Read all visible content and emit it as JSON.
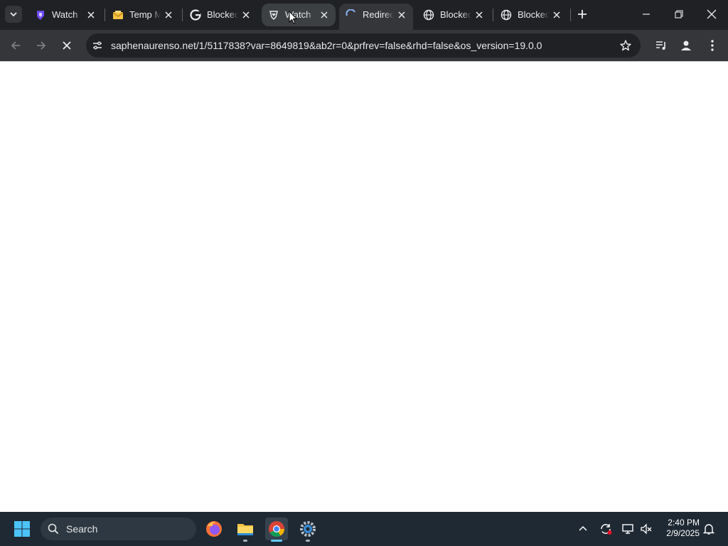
{
  "tabs": [
    {
      "title": "Watch",
      "favicon": "proton-vpn-icon",
      "state": "normal"
    },
    {
      "title": "Temp Mail",
      "favicon": "temp-mail-icon",
      "state": "normal"
    },
    {
      "title": "Blocked",
      "favicon": "google-icon",
      "state": "normal"
    },
    {
      "title": "Watch",
      "favicon": "brave-icon",
      "state": "hover"
    },
    {
      "title": "Redirecting",
      "favicon": "loading-spinner-icon",
      "state": "active"
    },
    {
      "title": "Blocked",
      "favicon": "globe-icon",
      "state": "normal"
    },
    {
      "title": "Blocked",
      "favicon": "globe-icon",
      "state": "normal"
    }
  ],
  "address_bar": {
    "url": "saphenaurenso.net/1/5117838?var=8649819&ab2r=0&prfrev=false&rhd=false&os_version=19.0.0"
  },
  "taskbar": {
    "search_label": "Search",
    "pinned_apps": [
      "firefox-icon",
      "file-explorer-icon",
      "chrome-icon",
      "settings-icon"
    ],
    "clock": {
      "time": "2:40 PM",
      "date": "2/9/2025"
    }
  },
  "colors": {
    "tabstrip_bg": "#202124",
    "toolbar_bg": "#35363a",
    "taskbar_bg": "#1f2933",
    "accent": "#60cdff"
  }
}
